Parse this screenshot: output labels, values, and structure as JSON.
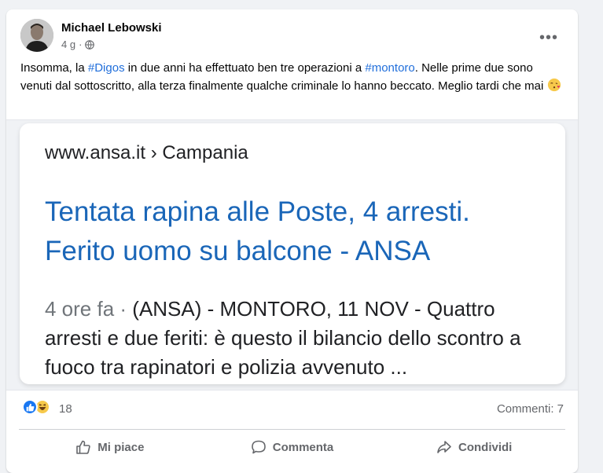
{
  "post": {
    "author": "Michael Lebowski",
    "time": "4 g",
    "privacy_icon": "globe-icon",
    "text": {
      "t1": "Insomma, la ",
      "tag1": "#Digos",
      "t2": " in due anni ha effettuato ben tre operazioni a ",
      "tag2": "#montoro",
      "t3": ". Nelle prime due sono venuti dal sottoscritto, alla terza finalmente qualche criminale lo hanno beccato. Meglio tardi che mai "
    },
    "emoji": "kissing-heart-emoji"
  },
  "snippet": {
    "url": "www.ansa.it › Campania",
    "title_line1": "Tentata rapina alle Poste, 4 arresti.",
    "title_line2": "Ferito uomo su balcone - ANSA",
    "time": "4 ore fa · ",
    "body": "(ANSA) - MONTORO, 11 NOV - Quattro arresti e due feriti: è questo il bilancio dello scontro a fuoco tra rapinatori e polizia avvenuto ..."
  },
  "stats": {
    "reaction_icons": [
      "like-icon",
      "haha-icon"
    ],
    "reaction_count": "18",
    "comments": "Commenti: 7"
  },
  "actions": {
    "like": "Mi piace",
    "comment": "Commenta",
    "share": "Condividi"
  },
  "colors": {
    "hashtag": "#216fdb",
    "snippet_title": "#1a66b8",
    "like_blue": "#1877f2",
    "haha_yellow": "#f7c94b"
  }
}
